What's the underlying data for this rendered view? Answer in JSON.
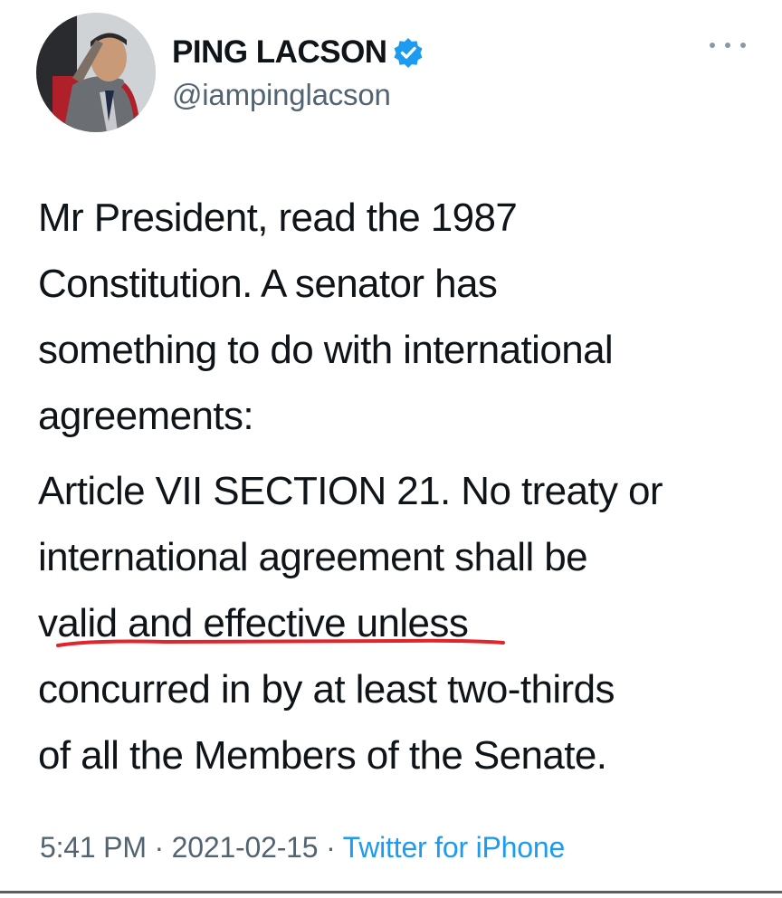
{
  "author": {
    "display_name": "PING LACSON",
    "handle": "@iampinglacson",
    "verified": true,
    "avatar_icon": "profile-photo-saluting-man"
  },
  "icons": {
    "verified": "verified-badge-icon",
    "more": "more-options-icon"
  },
  "tweet": {
    "paragraph1": [
      "Mr President, read the 1987",
      "Constitution. A senator has",
      "something to do with international",
      "agreements:"
    ],
    "paragraph2": [
      "Article VII SECTION 21. No treaty or",
      "international agreement shall be",
      "valid and effective unless",
      "concurred in by at least two-thirds",
      "of all the Members of the Senate."
    ]
  },
  "meta": {
    "time": "5:41 PM",
    "date": "2021-02-15",
    "separator": "·",
    "source": "Twitter for iPhone"
  },
  "colors": {
    "text": "#0f1419",
    "secondary": "#536471",
    "link": "#1d9bf0",
    "underline_mark": "#e0262b"
  }
}
